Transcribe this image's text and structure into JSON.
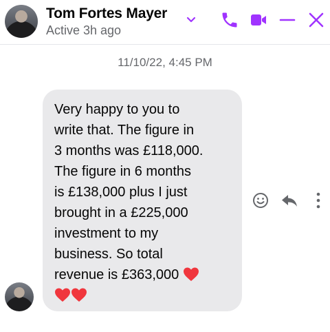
{
  "header": {
    "name": "Tom Fortes Mayer",
    "status": "Active 3h ago"
  },
  "icons": {
    "chevron": "chevron-down-icon",
    "call": "phone-icon",
    "video": "video-icon",
    "minimize": "minimize-icon",
    "close": "close-icon",
    "react": "smiley-icon",
    "reply": "reply-icon",
    "more": "more-vertical-icon",
    "heart": "heart-emoji"
  },
  "colors": {
    "accent": "#a033ff",
    "bubble": "#e9e9eb",
    "heart": "#f0363d"
  },
  "messages": [
    {
      "timestamp": "11/10/22, 4:45 PM",
      "text": "Very happy to you to\nwrite that. The figure in\n3 months was £118,000.\nThe figure in 6 months\nis £138,000 plus I just\nbrought in a £225,000\ninvestment to my\nbusiness. So total\nrevenue is £363,000"
    }
  ]
}
